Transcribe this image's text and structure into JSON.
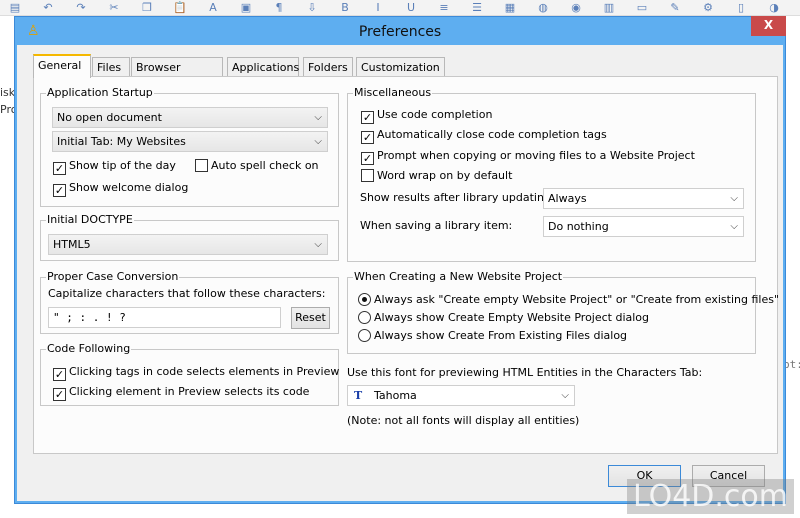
{
  "toolbar": {
    "icons": [
      "new-file-icon",
      "undo-icon",
      "redo-icon",
      "cut-icon",
      "copy-icon",
      "paste-icon",
      "font-icon",
      "image-icon",
      "paragraph-icon",
      "download-icon",
      "bold-icon",
      "italic-icon",
      "underline-icon",
      "align-icon",
      "list-icon",
      "picture-icon",
      "globe-icon",
      "color-icon",
      "table-icon",
      "form-icon",
      "edit-icon",
      "gear-icon",
      "layout-icon",
      "preview-icon"
    ]
  },
  "background": {
    "left_text": [
      "isk",
      "Proj"
    ],
    "right_text": "pt:"
  },
  "dialog": {
    "title": "Preferences",
    "close_label": "X"
  },
  "tabs": [
    "General",
    "Files",
    "Browser Testing",
    "Applications",
    "Folders",
    "Customization"
  ],
  "startup": {
    "legend": "Application Startup",
    "open_doc": "No open document",
    "initial_tab": "Initial Tab: My Websites",
    "show_tip": {
      "label": "Show tip of the day",
      "checked": true
    },
    "auto_spell": {
      "label": "Auto spell check on",
      "checked": false
    },
    "welcome": {
      "label": "Show welcome dialog",
      "checked": true
    }
  },
  "doctype": {
    "legend": "Initial DOCTYPE",
    "value": "HTML5"
  },
  "proper_case": {
    "legend": "Proper Case Conversion",
    "label": "Capitalize characters that follow these characters:",
    "value": "\"  ; : . ! ?",
    "reset": "Reset"
  },
  "code_following": {
    "legend": "Code Following",
    "items": [
      {
        "label": "Clicking tags in code selects elements in Preview",
        "checked": true
      },
      {
        "label": "Clicking element in Preview selects its code",
        "checked": true
      }
    ]
  },
  "misc": {
    "legend": "Miscellaneous",
    "items": [
      {
        "label": "Use code completion",
        "checked": true
      },
      {
        "label": "Automatically close code completion tags",
        "checked": true
      },
      {
        "label": "Prompt when copying or moving files to a Website Project",
        "checked": true
      },
      {
        "label": "Word wrap on by default",
        "checked": false
      }
    ],
    "results_label": "Show results after library updating:",
    "results_value": "Always",
    "saving_label": "When saving a library item:",
    "saving_value": "Do nothing"
  },
  "new_project": {
    "legend": "When Creating a New Website Project",
    "options": [
      "Always ask \"Create empty Website Project\" or \"Create from existing files\"",
      "Always show Create Empty Website Project dialog",
      "Always show Create From Existing Files dialog"
    ],
    "selected": 0
  },
  "font": {
    "label": "Use this font for previewing HTML Entities in the Characters Tab:",
    "value": "Tahoma",
    "note": "(Note: not all fonts will display all entities)"
  },
  "buttons": {
    "ok": "OK",
    "cancel": "Cancel"
  },
  "watermark": "LO4D.com"
}
